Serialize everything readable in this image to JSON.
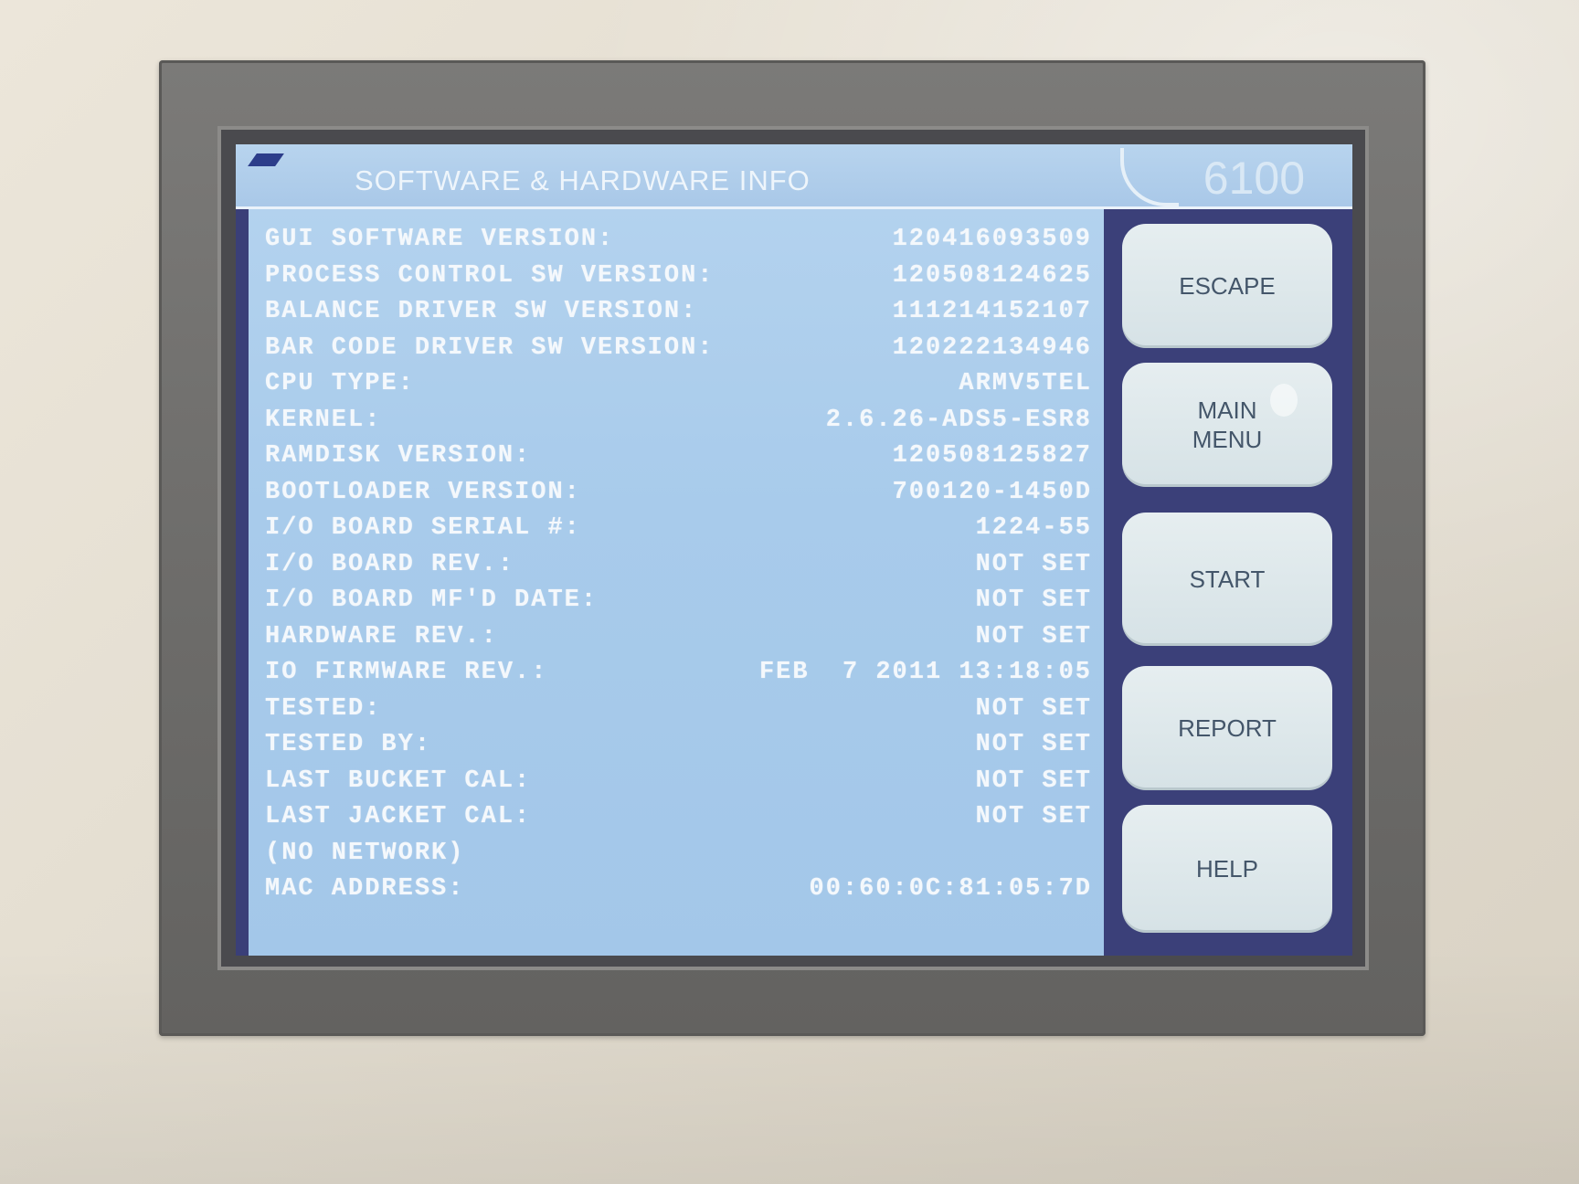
{
  "screen": {
    "title": "SOFTWARE & HARDWARE INFO",
    "model": "6100"
  },
  "info": {
    "rows": [
      {
        "label": "GUI SOFTWARE VERSION:",
        "value": "120416093509"
      },
      {
        "label": "PROCESS CONTROL SW VERSION:",
        "value": "120508124625"
      },
      {
        "label": "BALANCE DRIVER SW VERSION:",
        "value": "111214152107"
      },
      {
        "label": "BAR CODE DRIVER SW VERSION:",
        "value": "120222134946"
      },
      {
        "label": "CPU TYPE:",
        "value": "ARMV5TEL"
      },
      {
        "label": "KERNEL:",
        "value": "2.6.26-ADS5-ESR8"
      },
      {
        "label": "RAMDISK VERSION:",
        "value": "120508125827"
      },
      {
        "label": "BOOTLOADER VERSION:",
        "value": "700120-1450D"
      },
      {
        "label": "I/O BOARD SERIAL #:",
        "value": "1224-55"
      },
      {
        "label": "I/O BOARD REV.:",
        "value": "NOT SET"
      },
      {
        "label": "I/O BOARD MF'D DATE:",
        "value": "NOT SET"
      },
      {
        "label": "HARDWARE REV.:",
        "value": "NOT SET"
      },
      {
        "label": "IO FIRMWARE REV.:",
        "value": "FEB  7 2011 13:18:05"
      },
      {
        "label": "TESTED:",
        "value": "NOT SET"
      },
      {
        "label": "TESTED BY:",
        "value": "NOT SET"
      },
      {
        "label": "LAST BUCKET CAL:",
        "value": "NOT SET"
      },
      {
        "label": "LAST JACKET CAL:",
        "value": "NOT SET"
      },
      {
        "label": "(NO NETWORK)",
        "value": ""
      },
      {
        "label": "MAC ADDRESS:",
        "value": "00:60:0C:81:05:7D"
      }
    ]
  },
  "buttons": {
    "escape": "ESCAPE",
    "main_menu": "MAIN\nMENU",
    "start": "START",
    "report": "REPORT",
    "help": "HELP"
  },
  "colors": {
    "screen_background": "#a8cbeb",
    "button_column": "#3b4079",
    "button_face": "#dde7ea",
    "text": "#f4f8fc",
    "bezel": "#6e6d6b",
    "housing": "#e3ddd0"
  }
}
